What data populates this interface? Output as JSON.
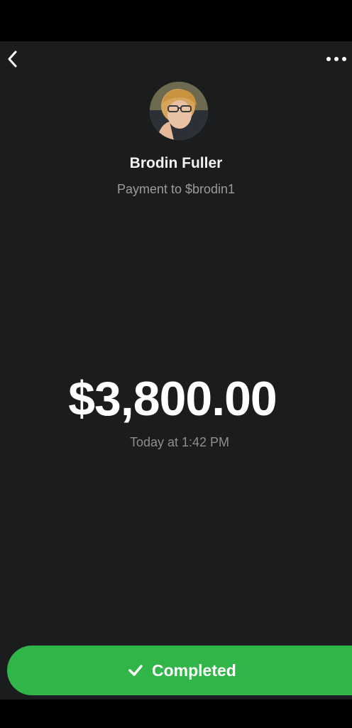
{
  "header": {
    "back_icon": "chevron-left-icon",
    "more_icon": "more-horizontal-icon"
  },
  "recipient": {
    "name": "Brodin Fuller",
    "subtitle": "Payment to $brodin1",
    "avatar": "avatar-photo"
  },
  "payment": {
    "amount": "$3,800.00",
    "timestamp": "Today at 1:42 PM"
  },
  "status": {
    "label": "Completed",
    "icon": "check-icon",
    "color": "#2fb548"
  },
  "colors": {
    "background": "#1b1c1d",
    "text_primary": "#ffffff",
    "text_secondary": "#9c9c9c",
    "accent": "#2fb548"
  }
}
